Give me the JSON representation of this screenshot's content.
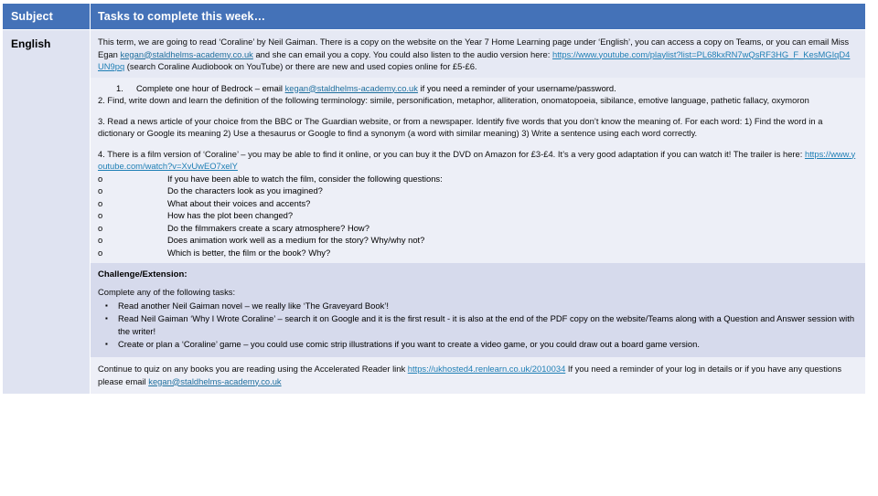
{
  "table": {
    "headers": {
      "subject": "Subject",
      "tasks": "Tasks to complete this week…"
    },
    "row": {
      "subject": "English",
      "intro": {
        "text_1": "This term, we are going to read ‘Coraline’ by Neil Gaiman. There is a copy on the website on the Year 7 Home Learning page under ‘English’, you can access a copy on Teams, or you can email Miss Egan ",
        "email_1": "kegan@staldhelms-academy.co.uk",
        "text_2": " and she can email you a copy. You could also listen to the audio version here: ",
        "link_1": "https://www.youtube.com/playlist?list=PL68kxRN7wQsRF3HG_F_KesMGIqD4UN9pq",
        "text_3": " (search Coraline Audiobook on YouTube) or there are new and used copies online for £5-£6."
      },
      "task_1": {
        "marker": "1.",
        "text_1": "Complete one hour of Bedrock – email ",
        "email": "kegan@staldhelms-academy.co.uk",
        "text_2": " if you need a reminder of your username/password."
      },
      "task_2": "2. Find, write down and learn the definition of the following terminology: simile, personification, metaphor, alliteration, onomatopoeia, sibilance, emotive language, pathetic fallacy, oxymoron",
      "task_3": "3. Read a news article of your choice from the BBC or The Guardian website, or from a newspaper. Identify five words that you don’t know the meaning of. For each word: 1) Find the word in a dictionary or Google its meaning 2) Use a thesaurus or Google to find a synonym (a word with similar meaning) 3) Write a sentence using each word correctly.",
      "task_4": {
        "text_1": "4. There is a film version of ‘Coraline’ – you may be able to find it online, or you can buy it the DVD on Amazon for £3-£4. It’s a very good adaptation if you can watch it! The trailer is here: ",
        "link": "https://www.youtube.com/watch?v=XvUwEO7xelY"
      },
      "film_questions": {
        "marker": "o",
        "items": [
          "If you have been able to watch the film, consider the following questions:",
          "Do the characters look as you imagined?",
          "What about their voices and accents?",
          "How has the plot been changed?",
          "Do the filmmakers create a scary atmosphere? How?",
          "Does animation work well as a medium for the story? Why/why not?",
          "Which is better, the film or the book? Why?"
        ]
      },
      "challenge": {
        "title": "Challenge/Extension:",
        "intro": "Complete any of the following tasks:",
        "bullet_glyph": "▪",
        "items": [
          "Read another Neil Gaiman novel – we really like ‘The Graveyard Book’!",
          "Read Neil Gaiman ‘Why I Wrote Coraline’ – search it on Google and it is the first result - it is also at the end of the PDF copy on the website/Teams along with a Question and Answer session with the writer!",
          "Create or plan a ‘Coraline’ game – you could use comic strip illustrations if you want to create a video game, or you could draw out a board game version."
        ]
      },
      "footer": {
        "text_1": "Continue to quiz on any books you are reading using the Accelerated Reader link ",
        "link": "https://ukhosted4.renlearn.co.uk/2010034",
        "text_2": "  If you need a reminder of your log in details or if you have any questions please email ",
        "email": "kegan@staldhelms-academy.co.uk"
      }
    }
  },
  "colors": {
    "header_blue": "#4472b8",
    "subject_bg": "#dfe3f1",
    "tasks_bg": "#edeff7",
    "challenge_bg": "#d6daec",
    "link": "#1f7fb5"
  }
}
